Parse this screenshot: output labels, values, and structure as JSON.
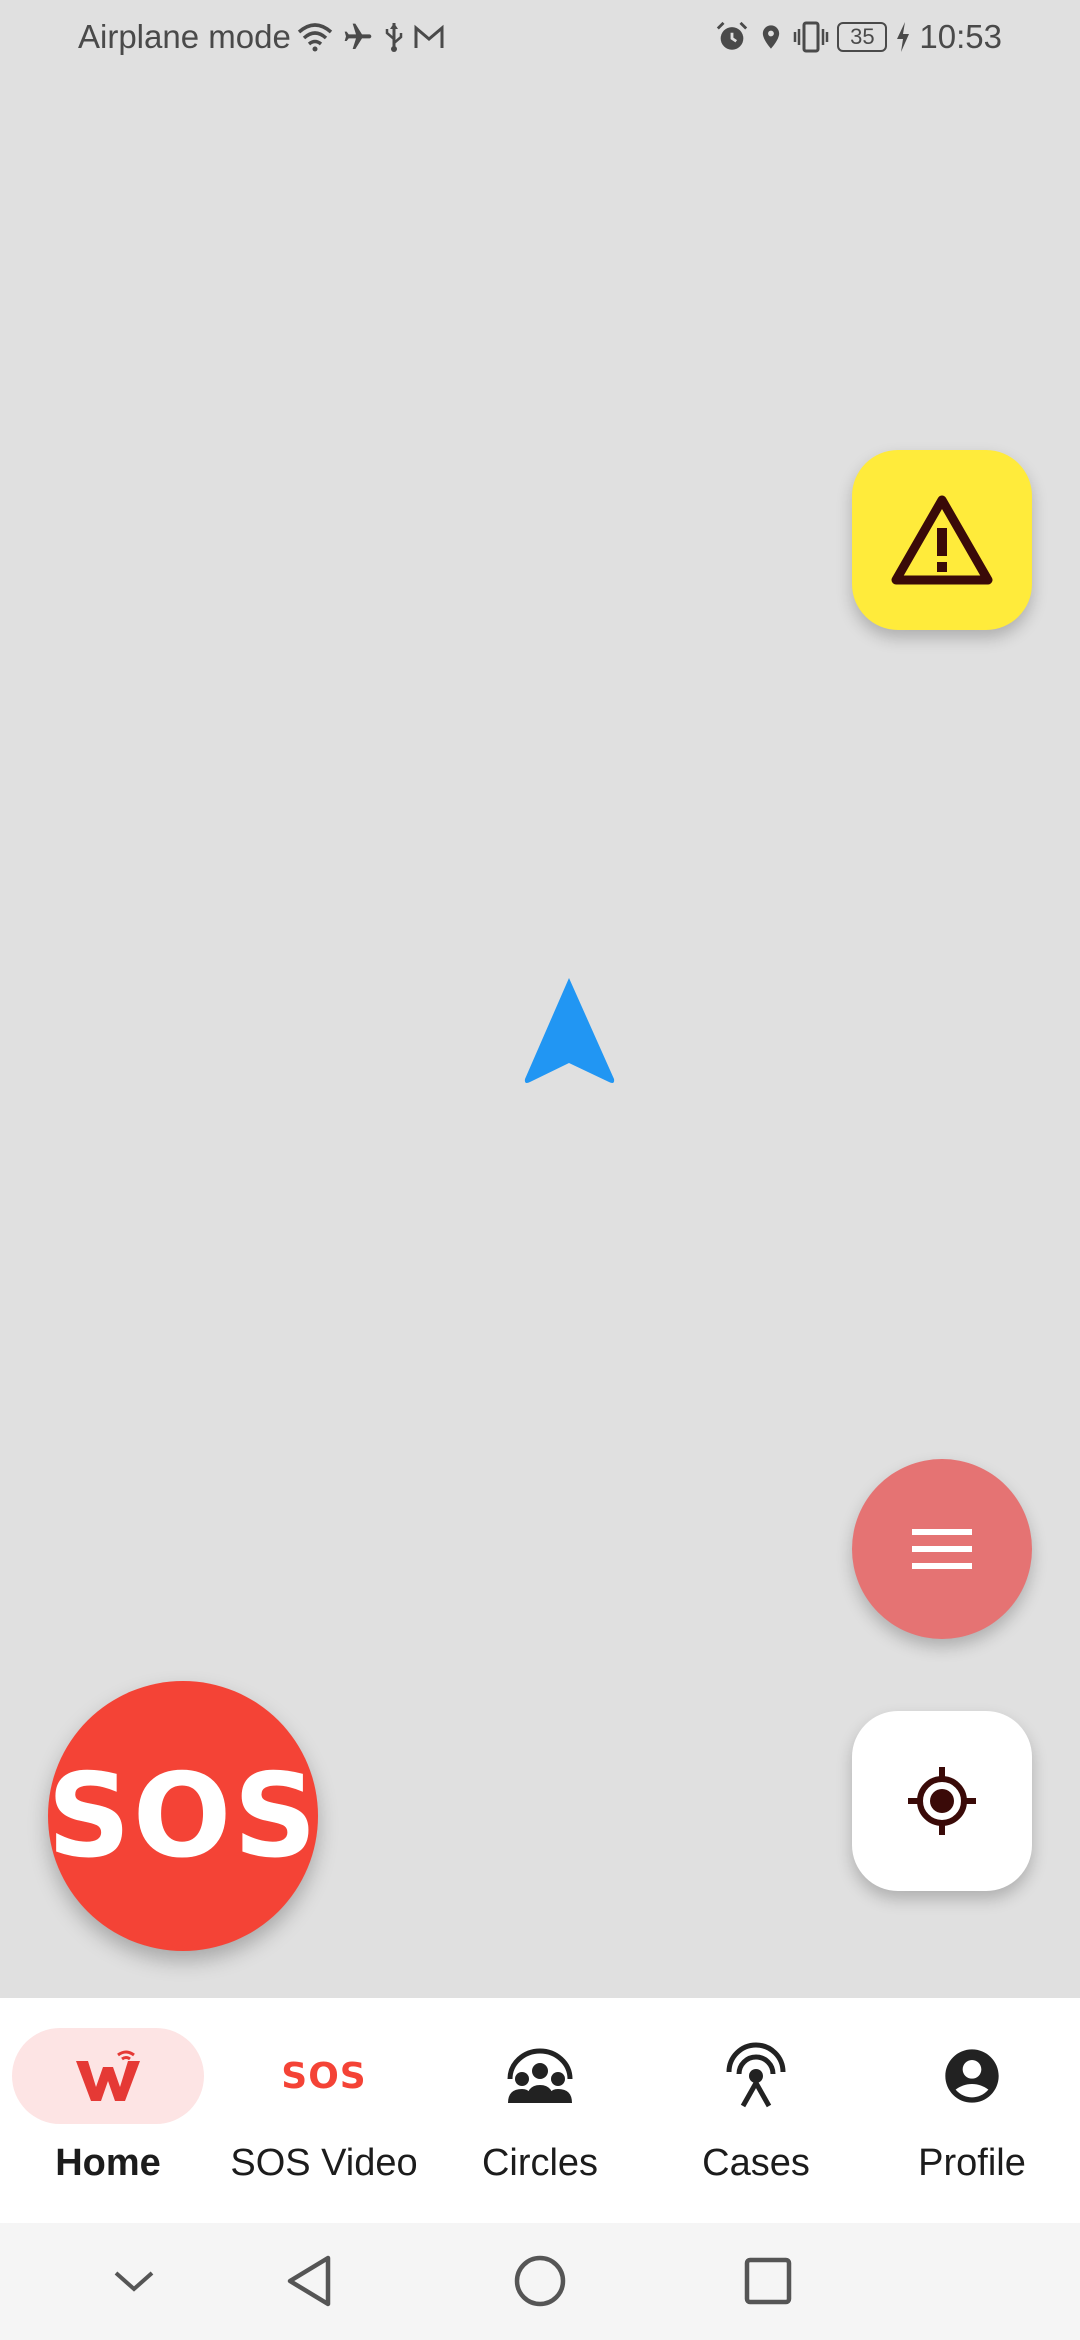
{
  "status_bar": {
    "left_text": "Airplane mode",
    "time": "10:53",
    "battery": "35",
    "icons_left": [
      "wifi-icon",
      "airplane-icon",
      "usb-icon",
      "gmail-icon"
    ],
    "icons_right": [
      "alarm-icon",
      "location-pin-icon",
      "vibrate-icon",
      "battery-icon",
      "charging-icon"
    ]
  },
  "map": {
    "location_marker": "navigation-arrow-icon",
    "marker_color": "#2196f3"
  },
  "fabs": {
    "warning_icon": "warning-icon",
    "menu_icon": "menu-icon",
    "locate_icon": "my-location-icon"
  },
  "sos_button": {
    "label": "SOS"
  },
  "bottom_nav": {
    "items": [
      {
        "label": "Home",
        "icon": "home-w-icon",
        "active": true
      },
      {
        "label": "SOS Video",
        "icon_text": "SOS",
        "icon": "sos-video-icon"
      },
      {
        "label": "Circles",
        "icon": "group-icon"
      },
      {
        "label": "Cases",
        "icon": "broadcast-icon"
      },
      {
        "label": "Profile",
        "icon": "account-circle-icon"
      }
    ]
  },
  "colors": {
    "sos_red": "#f44336",
    "warning_yellow": "#ffeb3b",
    "menu_fab": "#e57373",
    "active_pill": "#fde4e4"
  }
}
